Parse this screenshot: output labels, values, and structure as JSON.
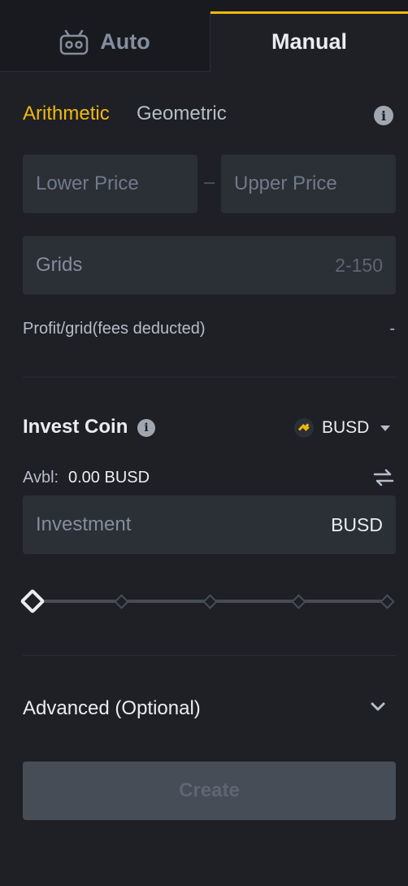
{
  "tabs": {
    "auto_label": "Auto",
    "manual_label": "Manual"
  },
  "mode": {
    "arithmetic": "Arithmetic",
    "geometric": "Geometric",
    "selected": "Arithmetic"
  },
  "price_range": {
    "lower_placeholder": "Lower Price",
    "upper_placeholder": "Upper Price"
  },
  "grids": {
    "placeholder": "Grids",
    "hint": "2-150"
  },
  "profit": {
    "label": "Profit/grid(fees deducted)",
    "value": "-"
  },
  "invest": {
    "label": "Invest Coin",
    "coin": "BUSD",
    "available_label": "Avbl:",
    "available_value": "0.00 BUSD",
    "input_placeholder": "Investment",
    "input_unit": "BUSD"
  },
  "slider": {
    "value_percent": 0,
    "stops": [
      0,
      25,
      50,
      75,
      100
    ]
  },
  "advanced": {
    "label": "Advanced (Optional)"
  },
  "create_button": {
    "label": "Create",
    "disabled": true
  },
  "colors": {
    "accent": "#f0b90b",
    "background": "#1e2026",
    "input_bg": "#2b2f36",
    "disabled_btn": "#474d57"
  },
  "icons": {
    "auto_tab": "robot-icon",
    "info": "info-icon",
    "coin": "busd-coin-icon",
    "swap": "swap-arrows-icon",
    "advanced": "chevron-down-icon"
  }
}
